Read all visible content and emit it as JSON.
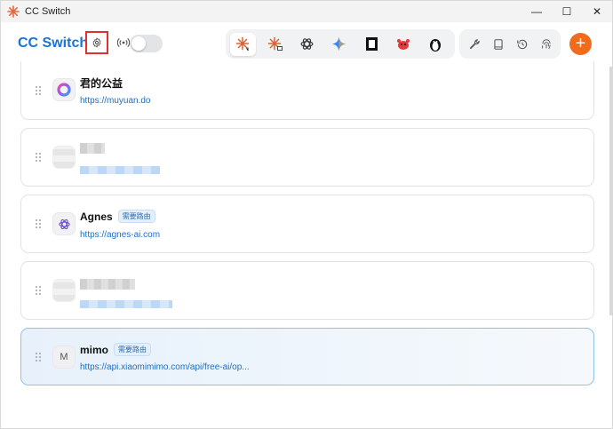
{
  "window": {
    "title": "CC Switch",
    "controls": {
      "minimize": "—",
      "maximize": "☐",
      "close": "✕"
    }
  },
  "toolbar": {
    "brand": "CC Switch",
    "icons": {
      "settings": "gear-icon",
      "proxy_signal": "signal-icon",
      "apps": [
        "claude-code-icon",
        "claude-desktop-icon",
        "openai-icon",
        "gemini-icon",
        "opencode-icon",
        "crab-icon",
        "penguin-icon"
      ],
      "tools": [
        "wrench-icon",
        "book-icon",
        "history-icon",
        "fingerprint-icon"
      ]
    },
    "add_label": "+",
    "toggle_on": false
  },
  "providers": [
    {
      "name": "君的公益",
      "url": "https://muyuan.do",
      "badge": "",
      "logo_icon": "ring-logo-icon",
      "redacted": false,
      "selected": false
    },
    {
      "name": "",
      "url": "",
      "badge": "",
      "logo_icon": "",
      "redacted": true,
      "selected": false
    },
    {
      "name": "Agnes",
      "url": "https://agnes-ai.com",
      "badge": "需要路由",
      "logo_icon": "openai-logo-icon",
      "redacted": false,
      "selected": false
    },
    {
      "name": "",
      "url": "",
      "badge": "",
      "logo_icon": "",
      "redacted": true,
      "selected": false
    },
    {
      "name": "mimo",
      "url": "https://api.xiaomimimo.com/api/free-ai/op...",
      "badge": "需要路由",
      "logo_letter": "M",
      "redacted": false,
      "selected": true
    }
  ],
  "colors": {
    "brand": "#1a73d8",
    "add_button": "#f26a1b",
    "link": "#1a6fc9",
    "highlight_box": "#e23030"
  }
}
